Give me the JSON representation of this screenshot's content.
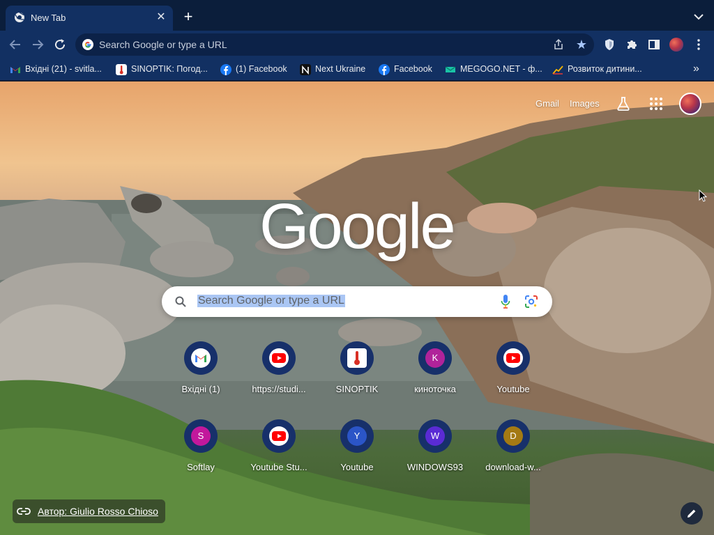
{
  "tab": {
    "title": "New Tab",
    "close_icon": "close-icon"
  },
  "toolbar": {
    "omnibox_text": "Search Google or type a URL"
  },
  "bookmarks": [
    {
      "label": "Вхідні (21) - svitla...",
      "icon": "gmail-icon"
    },
    {
      "label": "SINOPTIK: Погод...",
      "icon": "sinoptik-icon"
    },
    {
      "label": "(1) Facebook",
      "icon": "facebook-icon"
    },
    {
      "label": "Next Ukraine",
      "icon": "nextukraine-icon"
    },
    {
      "label": "Facebook",
      "icon": "facebook-icon"
    },
    {
      "label": "MEGOGO.NET - ф...",
      "icon": "megogo-icon"
    },
    {
      "label": "Розвиток дитини...",
      "icon": "chart-icon"
    }
  ],
  "ntp": {
    "gmail": "Gmail",
    "images": "Images",
    "logo": "Google",
    "search_placeholder": "Search Google or type a URL",
    "attribution": "Автор: Giulio Rosso Chioso"
  },
  "shortcuts": [
    {
      "label": "Вхідні (1)",
      "icon": "gmail-icon"
    },
    {
      "label": "https://studi...",
      "icon": "youtube-icon"
    },
    {
      "label": "SINOPTIK",
      "icon": "sinoptik-icon"
    },
    {
      "label": "киноточка",
      "letter": "K",
      "color": "#b0239a"
    },
    {
      "label": "Youtube",
      "icon": "youtube-icon"
    },
    {
      "label": "Softlay",
      "letter": "S",
      "color": "#c2189c"
    },
    {
      "label": "Youtube Stu...",
      "icon": "youtube-icon"
    },
    {
      "label": "Youtube",
      "letter": "Y",
      "color": "#2b55c7"
    },
    {
      "label": "WINDOWS93",
      "letter": "W",
      "color": "#5a2bd4"
    },
    {
      "label": "download-w...",
      "letter": "D",
      "color": "#a47a13"
    }
  ],
  "colors": {
    "frame": "#0b1e3b",
    "toolbar": "#123062",
    "accent": "#a8c7fa"
  }
}
